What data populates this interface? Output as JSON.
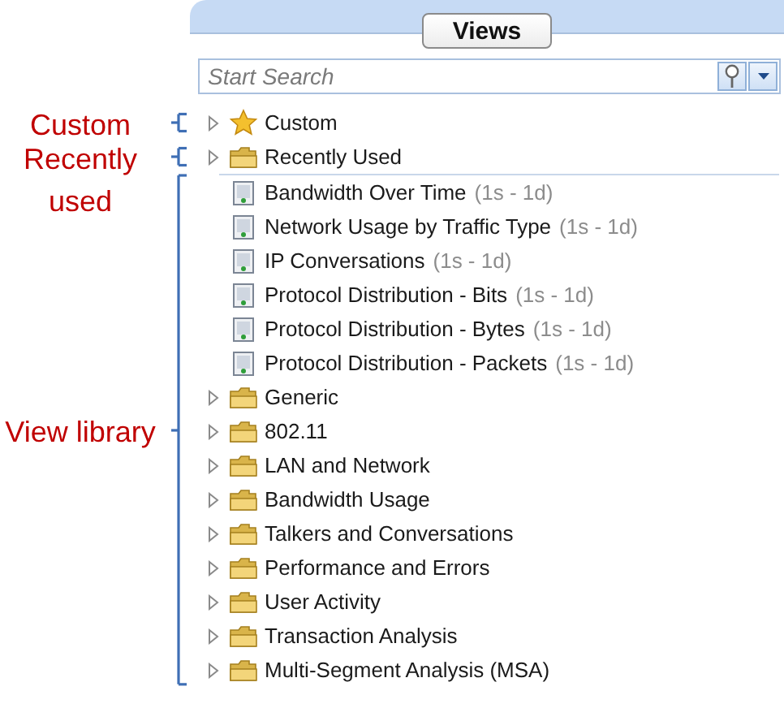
{
  "panel": {
    "title": "Views",
    "search": {
      "placeholder": "Start Search"
    }
  },
  "groups": [
    {
      "annotation": "Custom",
      "separated": false,
      "items": [
        {
          "kind": "favorites",
          "label": "Custom",
          "expanded": false
        }
      ]
    },
    {
      "annotation": "Recently used",
      "separated": false,
      "items": [
        {
          "kind": "folder",
          "label": "Recently Used",
          "expanded": false
        }
      ]
    },
    {
      "annotation": "View library",
      "separated": true,
      "items": [
        {
          "kind": "view",
          "label": "Bandwidth Over Time",
          "range": "(1s - 1d)"
        },
        {
          "kind": "view",
          "label": "Network Usage by Traffic Type",
          "range": "(1s - 1d)"
        },
        {
          "kind": "view",
          "label": "IP Conversations",
          "range": "(1s - 1d)"
        },
        {
          "kind": "view",
          "label": "Protocol Distribution - Bits",
          "range": "(1s - 1d)"
        },
        {
          "kind": "view",
          "label": "Protocol Distribution - Bytes",
          "range": "(1s - 1d)"
        },
        {
          "kind": "view",
          "label": "Protocol Distribution - Packets",
          "range": "(1s - 1d)"
        },
        {
          "kind": "folder",
          "label": "Generic",
          "expanded": false
        },
        {
          "kind": "folder",
          "label": "802.11",
          "expanded": false
        },
        {
          "kind": "folder",
          "label": "LAN and Network",
          "expanded": false
        },
        {
          "kind": "folder",
          "label": "Bandwidth Usage",
          "expanded": false
        },
        {
          "kind": "folder",
          "label": "Talkers and Conversations",
          "expanded": false
        },
        {
          "kind": "folder",
          "label": "Performance and Errors",
          "expanded": false
        },
        {
          "kind": "folder",
          "label": "User Activity",
          "expanded": false
        },
        {
          "kind": "folder",
          "label": "Transaction Analysis",
          "expanded": false
        },
        {
          "kind": "folder",
          "label": "Multi-Segment Analysis (MSA)",
          "expanded": false
        }
      ]
    }
  ]
}
